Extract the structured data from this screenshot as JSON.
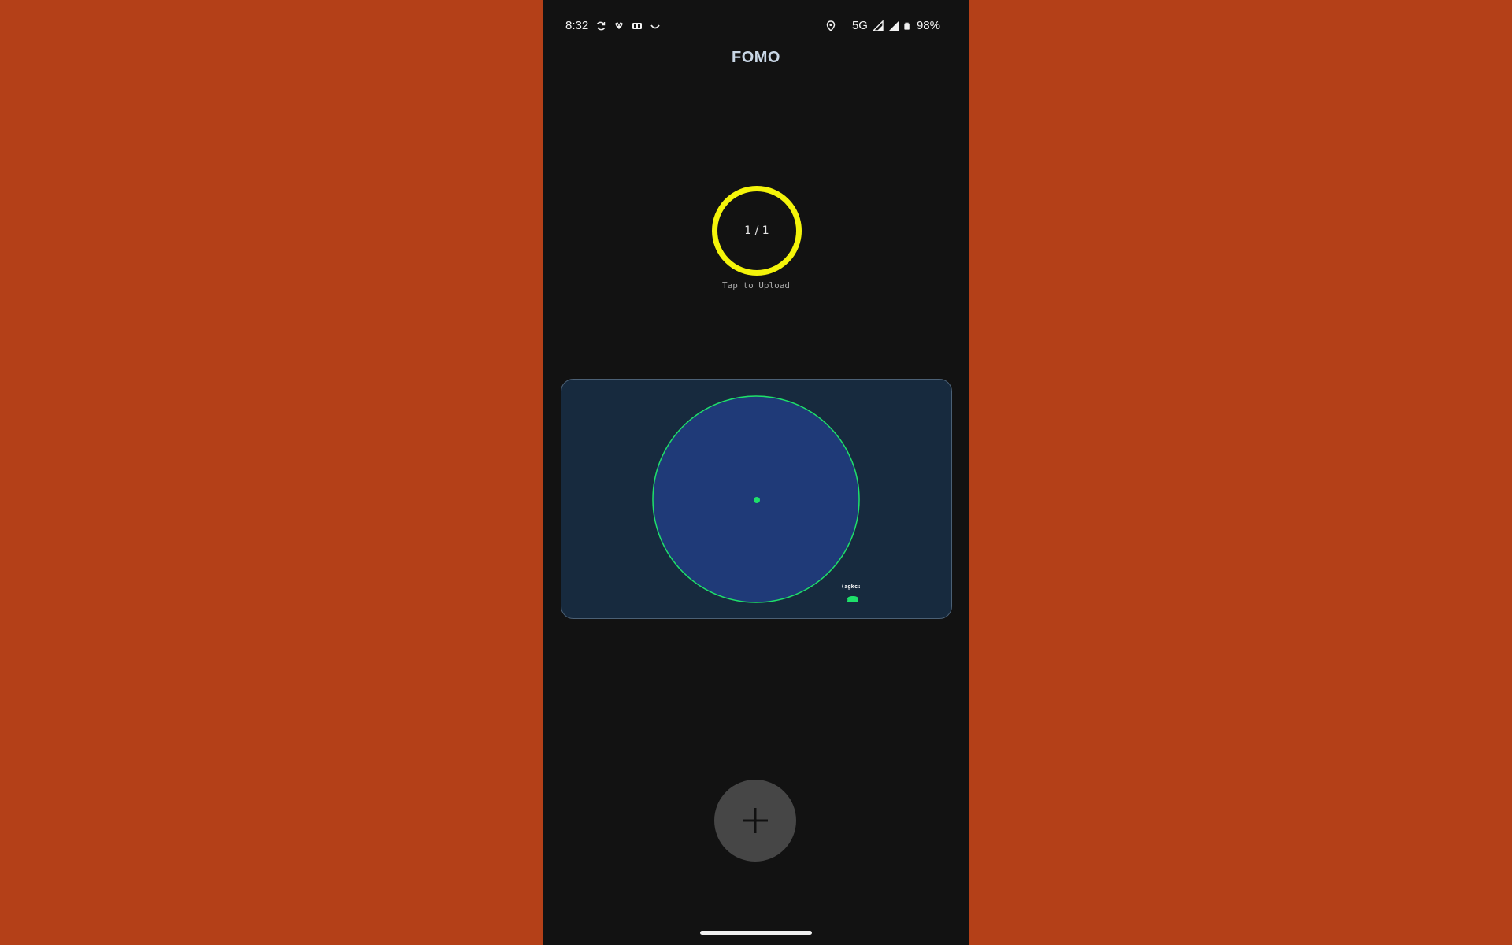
{
  "status_bar": {
    "time": "8:32",
    "network": "5G",
    "battery": "98%",
    "left_icons": [
      "sync-icon",
      "pet-icon",
      "sd-card-icon",
      "smile-icon"
    ],
    "right_icons": [
      "location-icon",
      "signal-icon",
      "signal-full-icon",
      "battery-icon"
    ]
  },
  "header": {
    "title": "FOMO"
  },
  "upload": {
    "count": "1 / 1",
    "hint": "Tap to Upload",
    "ring_color": "#f4f40a"
  },
  "radar": {
    "fill_color": "#1f3a78",
    "stroke_color": "#1ee06a",
    "marker_label": "(agkc:"
  },
  "fab": {
    "icon": "plus-icon"
  },
  "colors": {
    "background": "#b44018",
    "screen": "#121212",
    "card": "#172a3e"
  }
}
